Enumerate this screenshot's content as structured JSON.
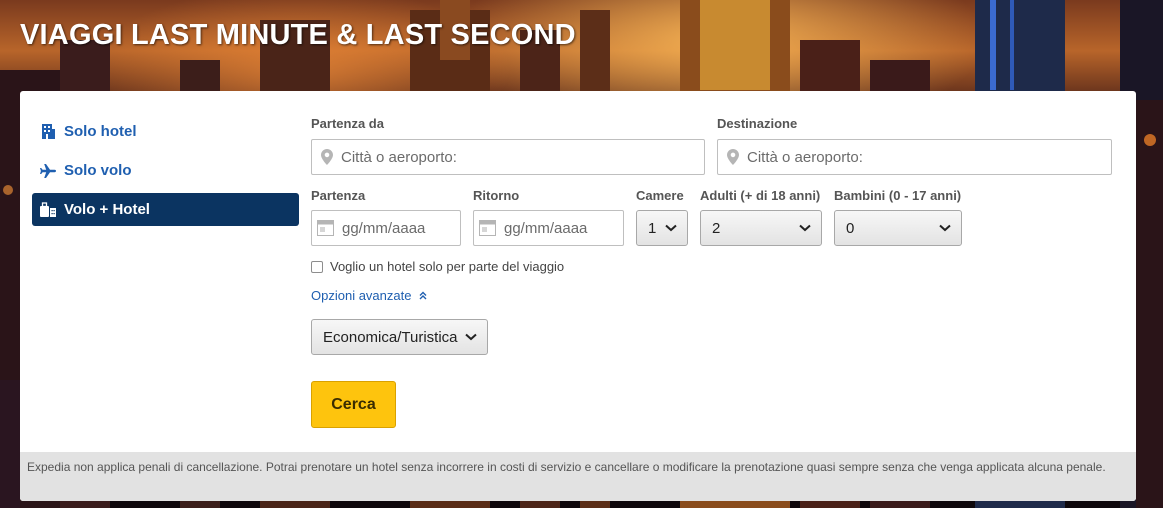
{
  "header": {
    "title": "VIAGGI LAST MINUTE & LAST SECOND"
  },
  "sidebar": {
    "items": [
      {
        "label": "Solo hotel",
        "icon": "hotel-icon",
        "active": false
      },
      {
        "label": "Solo volo",
        "icon": "plane-icon",
        "active": false
      },
      {
        "label": "Volo + Hotel",
        "icon": "suitcase-hotel-icon",
        "active": true
      }
    ]
  },
  "form": {
    "origin": {
      "label": "Partenza da",
      "placeholder": "Città o aeroporto:"
    },
    "destination": {
      "label": "Destinazione",
      "placeholder": "Città o aeroporto:"
    },
    "depart": {
      "label": "Partenza",
      "placeholder": "gg/mm/aaaa"
    },
    "return": {
      "label": "Ritorno",
      "placeholder": "gg/mm/aaaa"
    },
    "rooms": {
      "label": "Camere",
      "value": "1"
    },
    "adults": {
      "label": "Adulti (+ di 18 anni)",
      "value": "2"
    },
    "children": {
      "label": "Bambini (0 - 17 anni)",
      "value": "0"
    },
    "partial_hotel": {
      "label": "Voglio un hotel solo per parte del viaggio",
      "checked": false
    },
    "advanced_link": "Opzioni avanzate",
    "cabin_class": {
      "value": "Economica/Turistica"
    },
    "search_label": "Cerca"
  },
  "footer_note": "Expedia non applica penali di cancellazione. Potrai prenotare un hotel senza incorrere in costi di servizio e cancellare o modificare la prenotazione quasi sempre senza che venga applicata alcuna penale.",
  "colors": {
    "accent_link": "#1f5fb0",
    "active_tab": "#0b3461",
    "search_button": "#fec40d",
    "note_bg": "#e2e2e2"
  }
}
